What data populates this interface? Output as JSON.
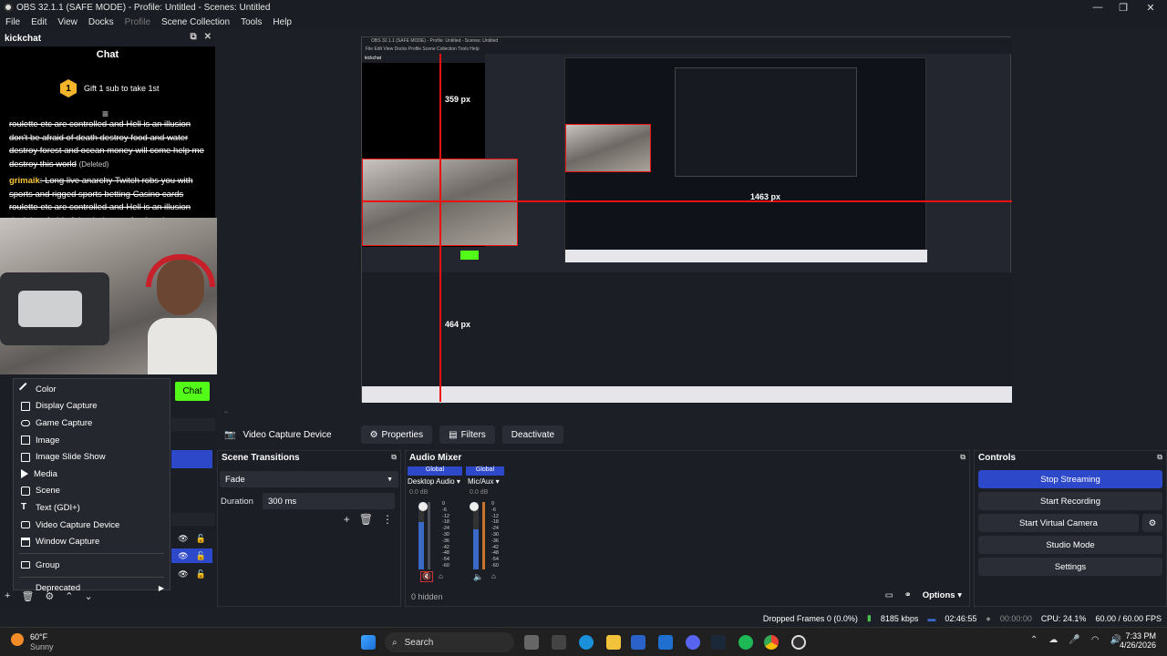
{
  "window": {
    "title": "OBS 32.1.1 (SAFE MODE) - Profile: Untitled - Scenes: Untitled"
  },
  "menu": [
    "File",
    "Edit",
    "View",
    "Docks",
    "Profile",
    "Scene Collection",
    "Tools",
    "Help"
  ],
  "kickchat": {
    "dock_title": "kickchat",
    "chat_title": "Chat",
    "gift_text": "Gift 1 sub to take 1st",
    "gift_badge": "1",
    "messages": [
      {
        "user": "",
        "text": "roulette etc are controlled and Hell is an illusion don't be afraid of death destroy food and water destroy forest and ocean money will come help me destroy this world",
        "deleted": "(Deleted)"
      },
      {
        "user": "grimaik",
        "text": ": Long live anarchy Twitch robs you with sports and rigged sports betting Casino cards roulette etc are controlled and Hell is an illusion don't be afraid of death destroy food and water",
        "deleted": ""
      }
    ],
    "chat_button": "Chat"
  },
  "context_menu": {
    "items": [
      {
        "label": "Color",
        "icon": "brush-icon"
      },
      {
        "label": "Display Capture",
        "icon": "monitor-icon"
      },
      {
        "label": "Game Capture",
        "icon": "gamepad-icon"
      },
      {
        "label": "Image",
        "icon": "image-icon"
      },
      {
        "label": "Image Slide Show",
        "icon": "slideshow-icon"
      },
      {
        "label": "Media",
        "icon": "media-icon"
      },
      {
        "label": "Scene",
        "icon": "scene-icon"
      },
      {
        "label": "Text (GDI+)",
        "icon": "text-icon"
      },
      {
        "label": "Video Capture Device",
        "icon": "camera-icon"
      },
      {
        "label": "Window Capture",
        "icon": "window-icon"
      },
      {
        "label": "Group",
        "icon": "folder-icon"
      },
      {
        "label": "Deprecated",
        "icon": "chevron-right-icon"
      }
    ]
  },
  "preview": {
    "label_359": "359 px",
    "label_1463": "1463 px",
    "label_464": "464 px",
    "inner_title": "OBS 32.1.1 (SAFE MODE) - Profile: Untitled - Scenes: Untitled",
    "inner_menu": "File  Edit  View  Docks  Profile  Scene Collection  Tools  Help",
    "inner_chat": "kickchat"
  },
  "source_toolbar": {
    "source_name": "Video Capture Device",
    "properties": "Properties",
    "filters": "Filters",
    "deactivate": "Deactivate"
  },
  "scene_transitions": {
    "title": "Scene Transitions",
    "transition": "Fade",
    "duration_label": "Duration",
    "duration_value": "300 ms"
  },
  "audio_mixer": {
    "title": "Audio Mixer",
    "channels": [
      {
        "scope": "Global",
        "name": "Desktop Audio",
        "db": "0.0 dB",
        "level": 0.7
      },
      {
        "scope": "Global",
        "name": "Mic/Aux",
        "db": "0.0 dB",
        "level": 0.6
      }
    ],
    "scale": [
      "0",
      "-6",
      "-12",
      "-18",
      "-24",
      "-30",
      "-36",
      "-42",
      "-48",
      "-54",
      "-60"
    ],
    "hidden": "0 hidden",
    "options": "Options"
  },
  "controls": {
    "title": "Controls",
    "stop_streaming": "Stop Streaming",
    "start_recording": "Start Recording",
    "start_virtual_camera": "Start Virtual Camera",
    "studio_mode": "Studio Mode",
    "settings": "Settings"
  },
  "status": {
    "dropped": "Dropped Frames 0 (0.0%)",
    "kbps": "8185 kbps",
    "stream_time": "02:46:55",
    "rec_time": "00:00:00",
    "cpu": "CPU: 24.1%",
    "fps": "60.00 / 60.00 FPS"
  },
  "taskbar": {
    "weather_temp": "60°F",
    "weather_desc": "Sunny",
    "search": "Search",
    "time": "7:33 PM",
    "date": "4/26/2026"
  },
  "colors": {
    "accent": "#2d48c9",
    "kick_green": "#53fc18",
    "guide_red": "#e11"
  }
}
